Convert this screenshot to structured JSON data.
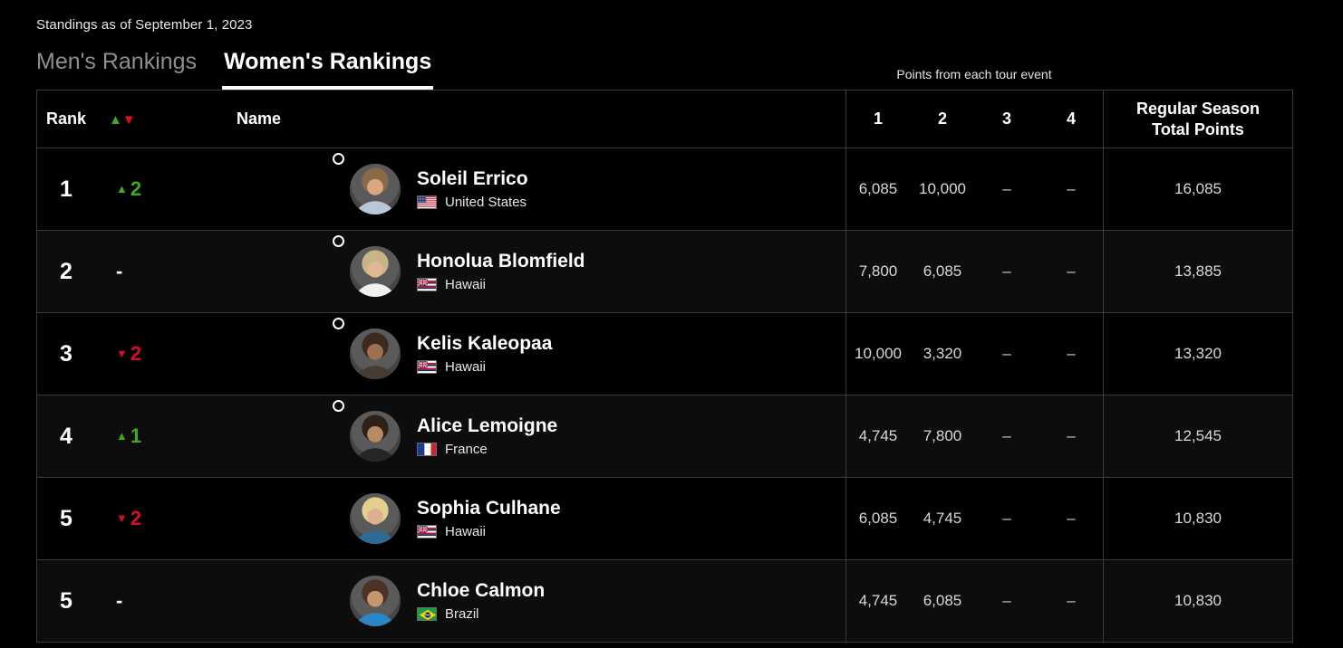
{
  "banner": {
    "alt": "ocean-wave-banner"
  },
  "header": {
    "standings_date": "Standings as of September 1, 2023"
  },
  "tabs": [
    {
      "id": "mens",
      "label": "Men's Rankings",
      "active": false
    },
    {
      "id": "womens",
      "label": "Women's Rankings",
      "active": true
    }
  ],
  "table": {
    "group_caption": "Points from each tour event",
    "columns": {
      "rank": "Rank",
      "move": "",
      "name": "Name",
      "events": [
        "1",
        "2",
        "3",
        "4"
      ],
      "total_line1": "Regular Season",
      "total_line2": "Total Points"
    },
    "sort_icons": {
      "up": "▲",
      "down": "▼"
    },
    "rows": [
      {
        "rank": "1",
        "move_dir": "up",
        "move_arrow": "▲",
        "move_value": "2",
        "marker": true,
        "name": "Soleil Errico",
        "country": "United States",
        "flag": "us",
        "events": [
          "6,085",
          "10,000",
          "–",
          "–"
        ],
        "total": "16,085"
      },
      {
        "rank": "2",
        "move_dir": "none",
        "move_arrow": "",
        "move_value": "-",
        "marker": true,
        "name": "Honolua Blomfield",
        "country": "Hawaii",
        "flag": "hi",
        "events": [
          "7,800",
          "6,085",
          "–",
          "–"
        ],
        "total": "13,885"
      },
      {
        "rank": "3",
        "move_dir": "down",
        "move_arrow": "▼",
        "move_value": "2",
        "marker": true,
        "name": "Kelis Kaleopaa",
        "country": "Hawaii",
        "flag": "hi",
        "events": [
          "10,000",
          "3,320",
          "–",
          "–"
        ],
        "total": "13,320"
      },
      {
        "rank": "4",
        "move_dir": "up",
        "move_arrow": "▲",
        "move_value": "1",
        "marker": true,
        "name": "Alice Lemoigne",
        "country": "France",
        "flag": "fr",
        "events": [
          "4,745",
          "7,800",
          "–",
          "–"
        ],
        "total": "12,545"
      },
      {
        "rank": "5",
        "move_dir": "down",
        "move_arrow": "▼",
        "move_value": "2",
        "marker": false,
        "name": "Sophia Culhane",
        "country": "Hawaii",
        "flag": "hi",
        "events": [
          "6,085",
          "4,745",
          "–",
          "–"
        ],
        "total": "10,830"
      },
      {
        "rank": "5",
        "move_dir": "none",
        "move_arrow": "",
        "move_value": "-",
        "marker": false,
        "name": "Chloe Calmon",
        "country": "Brazil",
        "flag": "br",
        "events": [
          "4,745",
          "6,085",
          "–",
          "–"
        ],
        "total": "10,830"
      }
    ]
  },
  "colors": {
    "up": "#3faa1e",
    "down": "#d50f28",
    "background": "#000000",
    "row_alt": "#0d0d0d",
    "border": "#3a3a3a",
    "accent": "#ffffff"
  }
}
